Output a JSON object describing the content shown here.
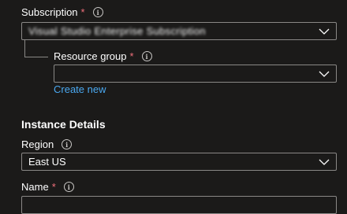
{
  "subscription": {
    "label": "Subscription",
    "required_mark": "*",
    "value": "Visual Studio Enterprise Subscription"
  },
  "resource_group": {
    "label": "Resource group",
    "required_mark": "*",
    "value": "",
    "create_new_label": "Create new"
  },
  "instance_details": {
    "heading": "Instance Details"
  },
  "region": {
    "label": "Region",
    "value": "East US"
  },
  "name": {
    "label": "Name",
    "required_mark": "*",
    "value": ""
  },
  "icons": {
    "info": "info-icon",
    "dropdown": "chevron-down-icon"
  },
  "colors": {
    "background": "#1b1a19",
    "required": "#f1707b",
    "link": "#4aa8f0",
    "border": "#8a8886"
  }
}
